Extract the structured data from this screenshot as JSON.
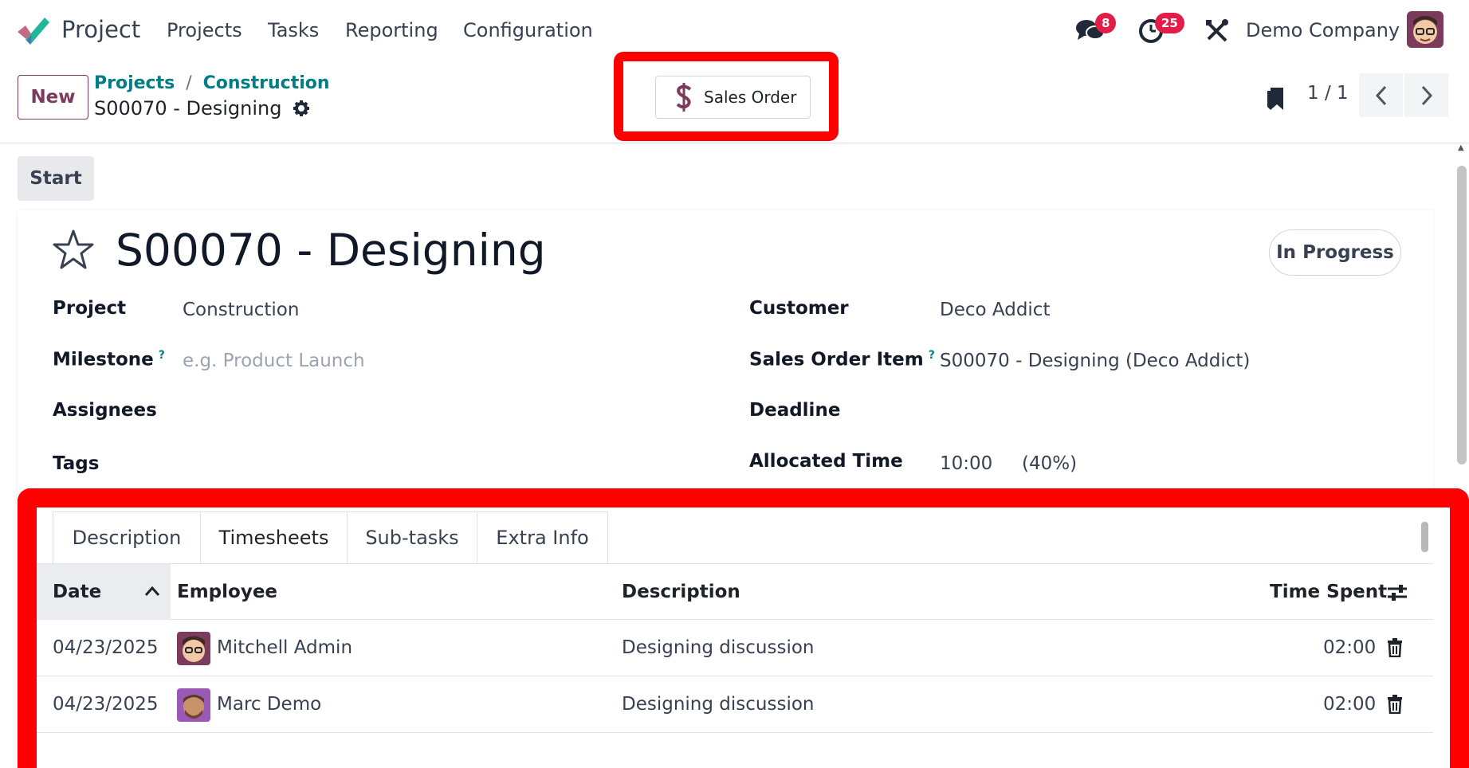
{
  "navbar": {
    "app_name": "Project",
    "menu": [
      "Projects",
      "Tasks",
      "Reporting",
      "Configuration"
    ],
    "messages_icon": "chat-icon",
    "messages_badge": "8",
    "activities_icon": "clock-icon",
    "activities_badge": "25",
    "debug_icon": "tools-icon",
    "company": "Demo Company"
  },
  "control_panel": {
    "new_label": "New",
    "breadcrumb": [
      "Projects",
      "Construction"
    ],
    "breadcrumb_sep": "/",
    "current": "S00070 - Designing",
    "smart_button": {
      "icon": "dollar-icon",
      "label": "Sales Order"
    },
    "pager": "1 / 1"
  },
  "statusbar": {
    "start_label": "Start"
  },
  "record": {
    "title": "S00070 - Designing",
    "stage": "In Progress",
    "fields_left": {
      "project_label": "Project",
      "project_value": "Construction",
      "milestone_label": "Milestone",
      "milestone_help": "?",
      "milestone_placeholder": "e.g. Product Launch",
      "assignees_label": "Assignees",
      "tags_label": "Tags"
    },
    "fields_right": {
      "customer_label": "Customer",
      "customer_value": "Deco Addict",
      "so_item_label": "Sales Order Item",
      "so_item_help": "?",
      "so_item_value": "S00070 - Designing (Deco Addict)",
      "deadline_label": "Deadline",
      "allocated_label": "Allocated Time",
      "allocated_value": "10:00",
      "allocated_pct": "(40%)"
    }
  },
  "notebook": {
    "tabs": [
      "Description",
      "Timesheets",
      "Sub-tasks",
      "Extra Info"
    ],
    "active_tab": "Timesheets",
    "columns": {
      "date": "Date",
      "employee": "Employee",
      "description": "Description",
      "time_spent": "Time Spent"
    },
    "rows": [
      {
        "date": "04/23/2025",
        "employee": "Mitchell Admin",
        "description": "Designing discussion",
        "time": "02:00"
      },
      {
        "date": "04/23/2025",
        "employee": "Marc Demo",
        "description": "Designing discussion",
        "time": "02:00"
      }
    ]
  },
  "colors": {
    "brand": "#7c3a5c",
    "link": "#017e84",
    "badge": "#e11d48",
    "highlight": "#ff0000"
  }
}
